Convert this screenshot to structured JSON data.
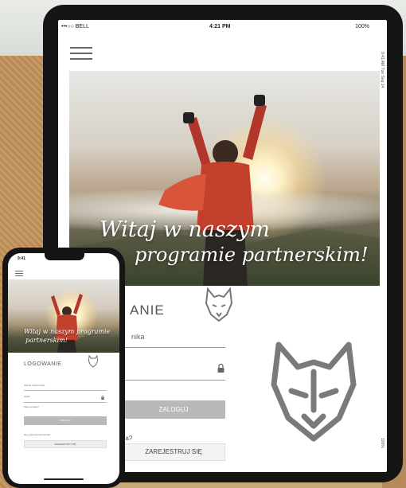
{
  "tablet": {
    "status": {
      "carrier": "•••○○ BELL",
      "time": "4:21 PM",
      "battery": "100%"
    },
    "side_text_top": "9:41 AM  Tue Sep 14",
    "side_text_bottom": "100%",
    "hero": {
      "line1": "Witaj w naszym",
      "line2": "programie partnerskim!"
    },
    "login": {
      "title": "ANIE",
      "username_label": "nika",
      "login_button": "ZALOGUJ",
      "register_prompt": "ea?",
      "register_button": "ZAREJESTRUJ SIĘ"
    }
  },
  "phone": {
    "status_time": "9:41",
    "hero": {
      "line1": "Witaj w naszym programie",
      "line2": "partnerskim!"
    },
    "login": {
      "title": "LOGOWANIE",
      "username_label": "Nazwa użytkownika",
      "password_label": "Hasło",
      "forgot": "Zapomniałeś?",
      "login_button": "ZALOGUJ",
      "register_prompt": "Nie masz jeszcze konta?",
      "register_button": "ZAREJESTRUJ SIĘ"
    }
  },
  "colors": {
    "button_gray": "#b9b9b9",
    "text_gray": "#555555",
    "device_frame": "#151515"
  },
  "icons": [
    "hamburger-menu-icon",
    "wolf-logo-icon",
    "lock-icon"
  ]
}
